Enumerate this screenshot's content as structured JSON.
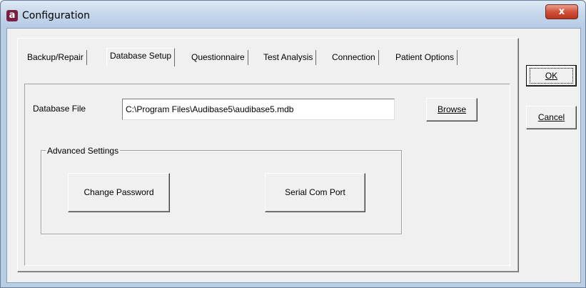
{
  "window": {
    "title": "Configuration",
    "icon": "app-a-icon",
    "close_label": "x"
  },
  "tabs": [
    {
      "label": "Backup/Repair",
      "active": false
    },
    {
      "label": "Database Setup",
      "active": true
    },
    {
      "label": "Questionnaire",
      "active": false
    },
    {
      "label": "Test Analysis",
      "active": false
    },
    {
      "label": "Connection",
      "active": false
    },
    {
      "label": "Patient Options",
      "active": false
    }
  ],
  "database": {
    "label": "Database File",
    "path": "C:\\Program Files\\Audibase5\\audibase5.mdb",
    "browse_label": "Browse"
  },
  "advanced": {
    "title": "Advanced Settings",
    "change_password_label": "Change Password",
    "serial_com_port_label": "Serial Com Port"
  },
  "dialog": {
    "ok_label": "OK",
    "cancel_label": "Cancel"
  }
}
